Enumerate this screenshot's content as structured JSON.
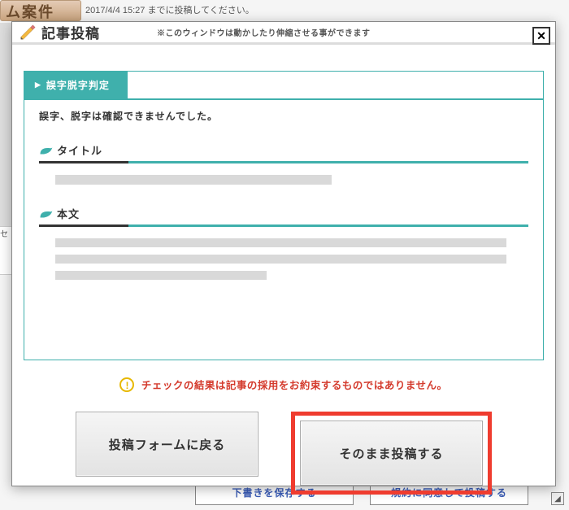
{
  "background": {
    "header_fragment": "ム案件",
    "deadline_text": "2017/4/4 15:27 までに投稿してください。",
    "sidebar_fragment": "セ",
    "bottom_button_draft": "下書きを保存する",
    "bottom_button_agree": "規約に同意して投稿する"
  },
  "modal": {
    "title": "記事投稿",
    "drag_hint": "※このウィンドウは動かしたり伸縮させる事ができます",
    "close_label": "✕",
    "tab_label": "誤字脱字判定",
    "tab_arrow": "▶",
    "result_message": "誤字、脱字は確認できませんでした。",
    "section_title": "タイトル",
    "section_body": "本文",
    "warning_icon": "!",
    "warning_text": "チェックの結果は記事の採用をお約束するものではありません。",
    "button_back": "投稿フォームに戻る",
    "button_submit": "そのまま投稿する"
  }
}
